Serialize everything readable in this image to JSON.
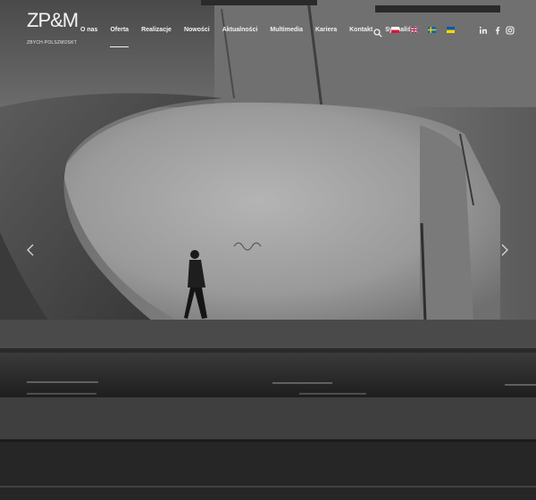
{
  "logo": {
    "mark": "ZP&M",
    "subtitle": "ZBYCH·POLSZMOSKT"
  },
  "nav": {
    "items": [
      {
        "label": "O nas",
        "active": false
      },
      {
        "label": "Oferta",
        "active": true
      },
      {
        "label": "Realizacje",
        "active": false
      },
      {
        "label": "Nowości",
        "active": false
      },
      {
        "label": "Aktualności",
        "active": false
      },
      {
        "label": "Multimedia",
        "active": false
      },
      {
        "label": "Kariera",
        "active": false
      },
      {
        "label": "Kontakt",
        "active": false
      },
      {
        "label": "Sygnaliści",
        "active": false
      }
    ]
  },
  "header_icons": {
    "search": "search-icon",
    "languages": [
      "flag-pl",
      "flag-uk",
      "flag-se",
      "flag-ua"
    ],
    "social": [
      "linkedin-icon",
      "facebook-icon",
      "instagram-icon"
    ]
  },
  "slider": {
    "prev_icon": "chevron-left-icon",
    "next_icon": "chevron-right-icon"
  },
  "colors": {
    "nav_text": "#f2f2f2",
    "concrete_dark": "#2f2f2f",
    "concrete_light": "#9a9a9a"
  }
}
